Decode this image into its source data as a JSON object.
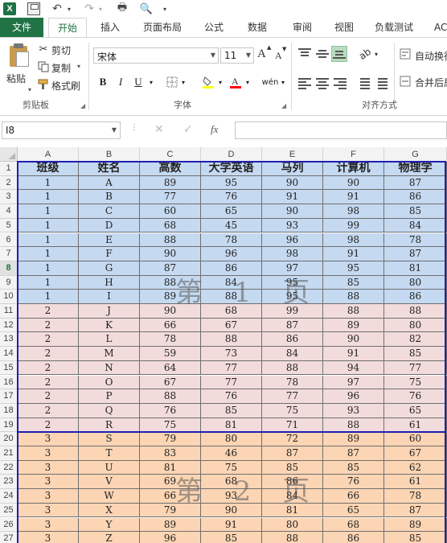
{
  "qat": {
    "excel_icon": "X",
    "undo_icon": "↶",
    "redo_icon": "↷",
    "print_icon": "🖶",
    "preview_icon": "🔍"
  },
  "tabs": [
    "文件",
    "开始",
    "插入",
    "页面布局",
    "公式",
    "数据",
    "审阅",
    "视图",
    "负载测试",
    "AC"
  ],
  "ribbon": {
    "paste": "粘贴",
    "cut": "剪切",
    "copy": "复制",
    "format_painter": "格式刷",
    "clipboard_label": "剪贴板",
    "font_name": "宋体",
    "font_size": "11",
    "grow_font": "A",
    "shrink_font": "A",
    "bold": "B",
    "italic": "I",
    "underline": "U",
    "phonetic": "wén",
    "font_label": "字体",
    "wrap_text": "自动换行",
    "merge_center": "合并后居",
    "alignment_label": "对齐方式"
  },
  "formula_bar": {
    "name_box": "I8",
    "fx": "fx",
    "formula": ""
  },
  "sheet": {
    "columns": [
      "A",
      "B",
      "C",
      "D",
      "E",
      "F",
      "G"
    ],
    "selected_row": 8,
    "headers": [
      "班级",
      "姓名",
      "高数",
      "大学英语",
      "马列",
      "计算机",
      "物理学"
    ],
    "rows": [
      [
        "1",
        "A",
        "89",
        "95",
        "90",
        "90",
        "87"
      ],
      [
        "1",
        "B",
        "77",
        "76",
        "91",
        "91",
        "86"
      ],
      [
        "1",
        "C",
        "60",
        "65",
        "90",
        "98",
        "85"
      ],
      [
        "1",
        "D",
        "68",
        "45",
        "93",
        "99",
        "84"
      ],
      [
        "1",
        "E",
        "88",
        "78",
        "96",
        "98",
        "78"
      ],
      [
        "1",
        "F",
        "90",
        "96",
        "98",
        "91",
        "87"
      ],
      [
        "1",
        "G",
        "87",
        "86",
        "97",
        "95",
        "81"
      ],
      [
        "1",
        "H",
        "88",
        "84",
        "95",
        "85",
        "80"
      ],
      [
        "1",
        "I",
        "89",
        "88",
        "95",
        "88",
        "86"
      ],
      [
        "2",
        "J",
        "90",
        "68",
        "99",
        "88",
        "88"
      ],
      [
        "2",
        "K",
        "66",
        "67",
        "87",
        "89",
        "80"
      ],
      [
        "2",
        "L",
        "78",
        "88",
        "86",
        "90",
        "82"
      ],
      [
        "2",
        "M",
        "59",
        "73",
        "84",
        "91",
        "85"
      ],
      [
        "2",
        "N",
        "64",
        "77",
        "88",
        "94",
        "77"
      ],
      [
        "2",
        "O",
        "67",
        "77",
        "78",
        "97",
        "75"
      ],
      [
        "2",
        "P",
        "88",
        "76",
        "77",
        "96",
        "76"
      ],
      [
        "2",
        "Q",
        "76",
        "85",
        "75",
        "93",
        "65"
      ],
      [
        "2",
        "R",
        "75",
        "81",
        "71",
        "88",
        "61"
      ],
      [
        "3",
        "S",
        "79",
        "80",
        "72",
        "89",
        "60"
      ],
      [
        "3",
        "T",
        "83",
        "46",
        "87",
        "87",
        "67"
      ],
      [
        "3",
        "U",
        "81",
        "75",
        "85",
        "85",
        "62"
      ],
      [
        "3",
        "V",
        "69",
        "68",
        "86",
        "76",
        "61"
      ],
      [
        "3",
        "W",
        "66",
        "93",
        "84",
        "66",
        "78"
      ],
      [
        "3",
        "X",
        "79",
        "90",
        "81",
        "65",
        "87"
      ],
      [
        "3",
        "Y",
        "89",
        "91",
        "80",
        "68",
        "89"
      ],
      [
        "3",
        "Z",
        "96",
        "85",
        "88",
        "86",
        "85"
      ]
    ],
    "extra_row": "28",
    "watermarks": [
      "第 1 页",
      "第 2 页"
    ],
    "group_colors": {
      "1": "#c5d9f1",
      "2": "#f2dcdb",
      "3": "#fcd5b4"
    },
    "header_color": "#c5d9f1",
    "page_break_color": "#1f1fb0"
  }
}
